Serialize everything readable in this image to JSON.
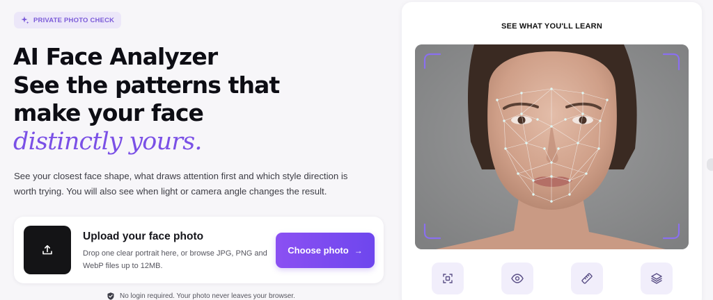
{
  "badge": {
    "icon": "sparkle-icon",
    "text": "PRIVATE PHOTO CHECK"
  },
  "headline": {
    "line1": "AI Face Analyzer",
    "line2": "See the patterns that",
    "line3": "make your face",
    "accent": "distinctly yours."
  },
  "subcopy": {
    "line1": "See your closest face shape, what draws attention first and which style direction is",
    "line2": "worth trying. You will also see when light or camera angle changes the result."
  },
  "upload": {
    "icon": "upload-icon",
    "title": "Upload your face photo",
    "description": "Drop one clear portrait here, or browse JPG, PNG and WebP files up to 12MB.",
    "button_label": "Choose photo",
    "button_arrow": "→"
  },
  "privacy": {
    "icon": "shield-check-icon",
    "text": "No login required. Your photo never leaves your browser."
  },
  "learn": {
    "title": "SEE WHAT YOU'LL LEARN",
    "feature_icons": [
      "face-frame-icon",
      "eye-icon",
      "ruler-icon",
      "layers-icon"
    ]
  },
  "colors": {
    "accent": "#7a50e6",
    "button_start": "#8b50f2",
    "button_end": "#6e46ee",
    "badge_bg": "#ece7f9",
    "upload_tile": "#141416"
  }
}
